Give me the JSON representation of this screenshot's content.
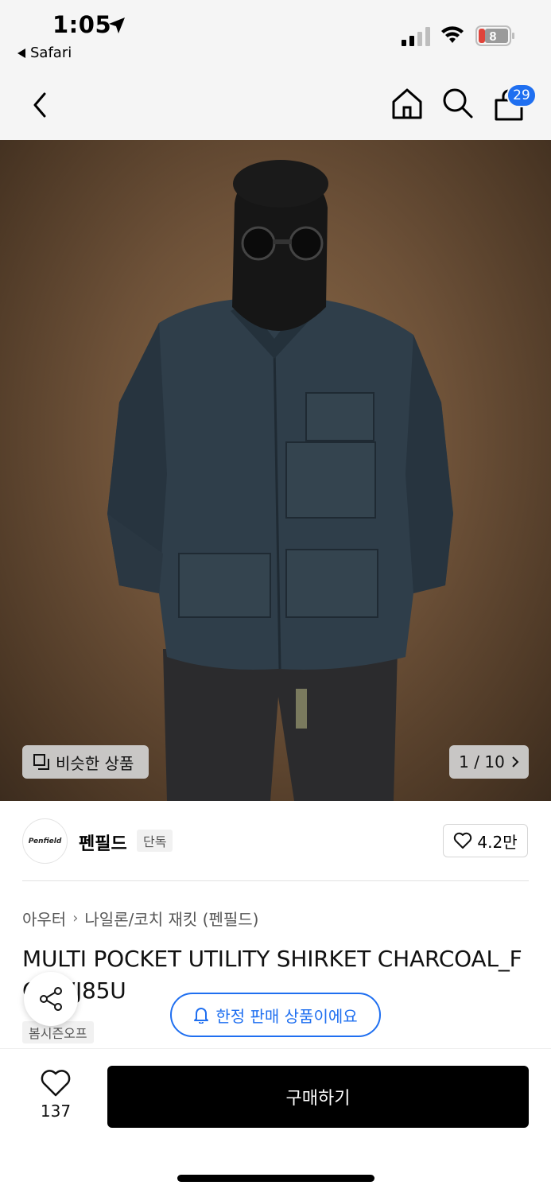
{
  "status_bar": {
    "time": "1:05",
    "back_app": "Safari",
    "battery": "8"
  },
  "nav": {
    "cart_count": "29",
    "icons": [
      "back-icon",
      "home-icon",
      "search-icon",
      "cart-icon"
    ]
  },
  "gallery": {
    "similar_label": "비슷한 상품",
    "pager": "1 / 10"
  },
  "brand": {
    "logo_text": "Penfield",
    "name": "펜필드",
    "tag": "단독",
    "likes": "4.2만"
  },
  "product": {
    "breadcrumb": [
      "아우터",
      "나일론/코치 재킷 (펜필드)"
    ],
    "title": "MULTI POCKET UTILITY SHIRKET CHARCOAL_FQ2WJ85U",
    "season_tag": "봄시즌오프",
    "limited_notice": "한정 판매 상품이에요"
  },
  "bottom": {
    "wish_count": "137",
    "buy_label": "구매하기"
  },
  "colors": {
    "accent": "#1f6ff0",
    "buy_button": "#000000"
  }
}
